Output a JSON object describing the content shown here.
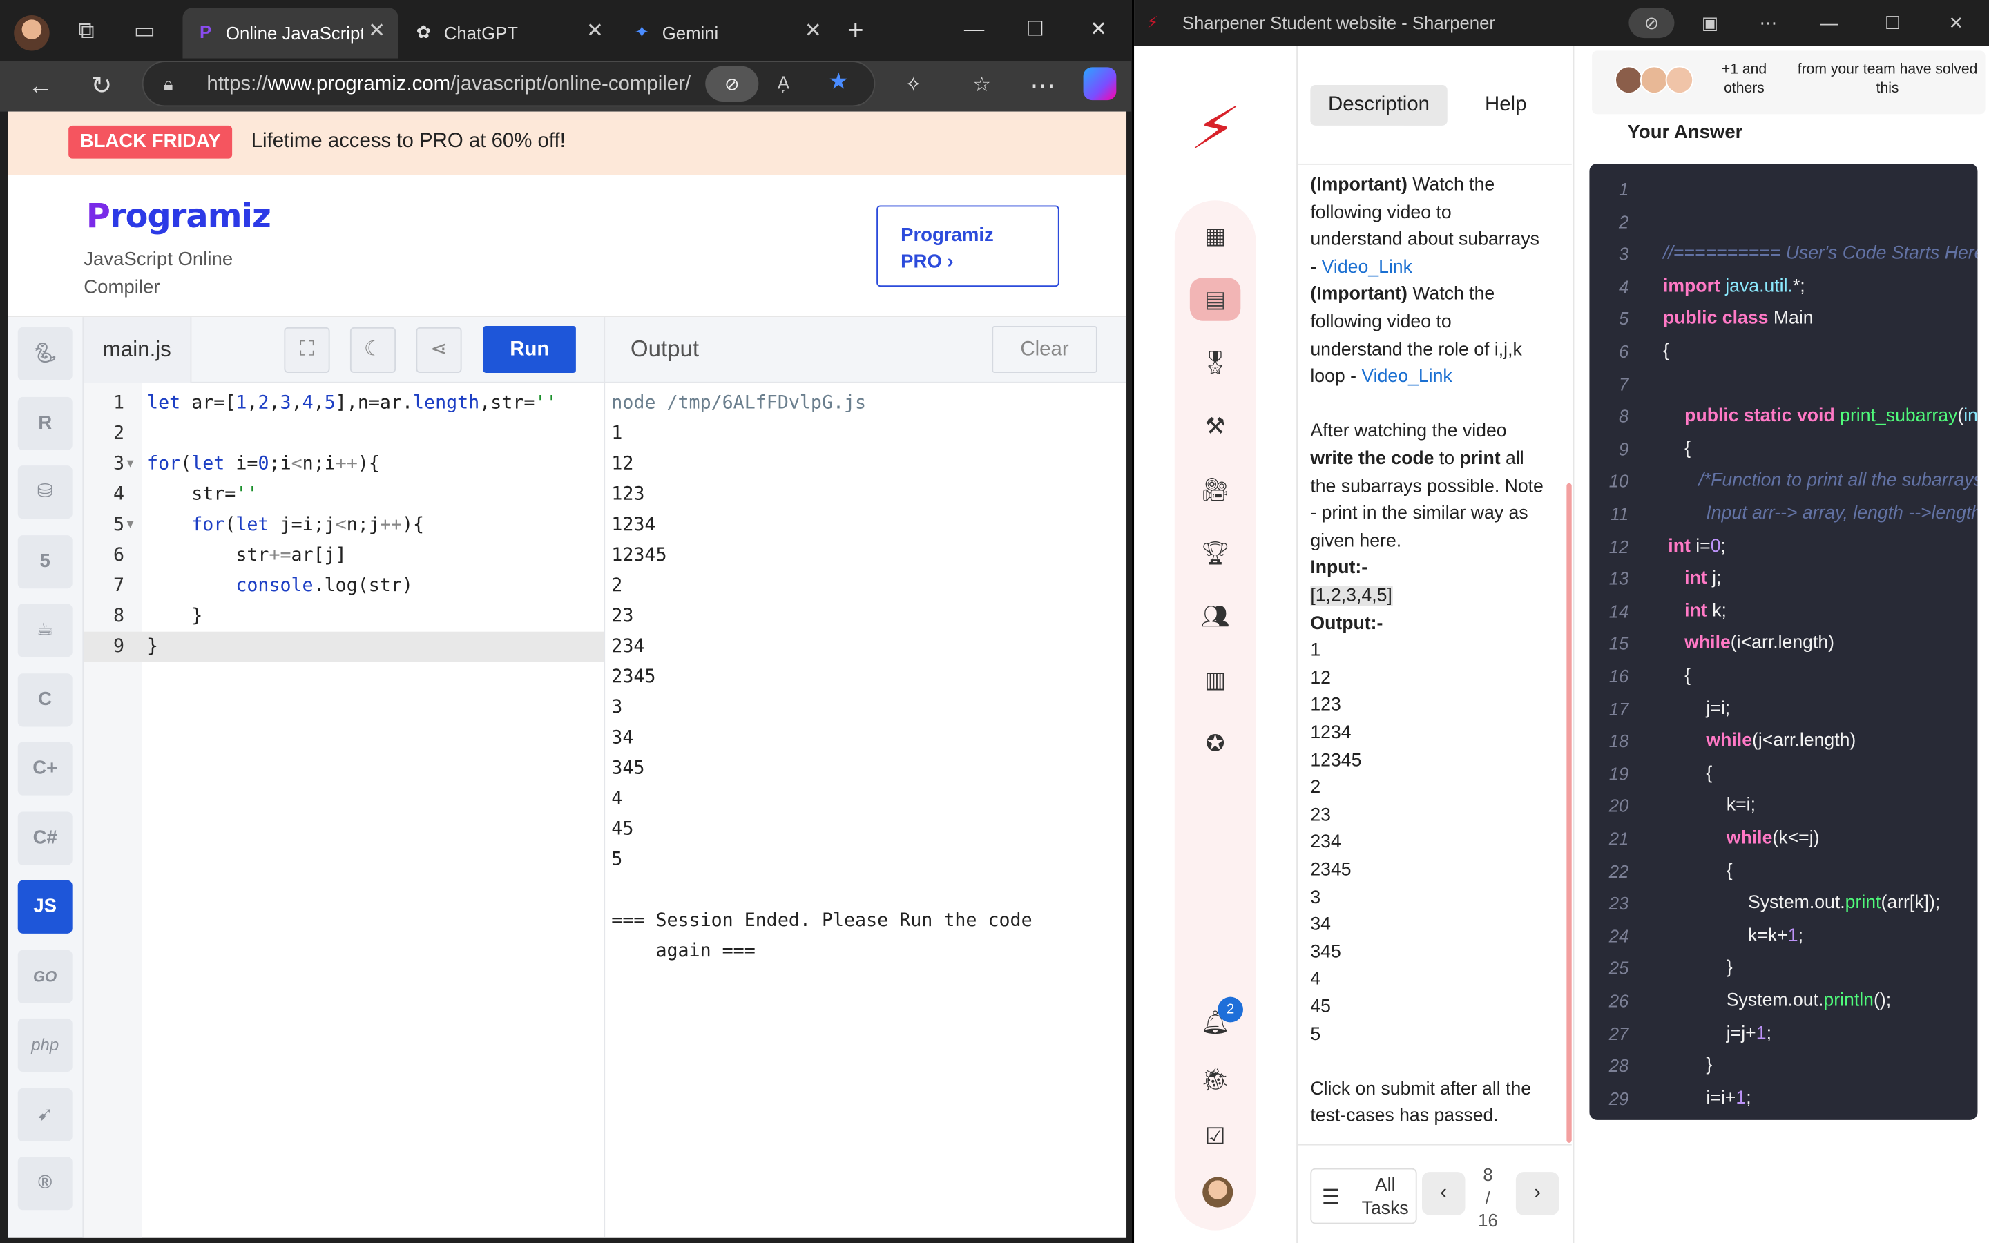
{
  "browser": {
    "tabs": [
      {
        "label": "Online JavaScript C",
        "icon": "programiz-icon"
      },
      {
        "label": "ChatGPT",
        "icon": "chatgpt-icon"
      },
      {
        "label": "Gemini",
        "icon": "gemini-icon"
      }
    ],
    "url_prefix": "https://",
    "url_domain": "www.programiz.com",
    "url_path": "/javascript/online-compiler/"
  },
  "programiz": {
    "promo_badge": "BLACK FRIDAY",
    "promo_text": "Lifetime access to PRO at 60% off!",
    "logo_first": "P",
    "logo_rest": "rogramiz",
    "subtitle": "JavaScript Online Compiler",
    "pro_button": "Programiz PRO ›",
    "languages": [
      "Python",
      "R",
      "SQL",
      "HTML",
      "Java",
      "C",
      "C++",
      "C#",
      "JS",
      "GO",
      "php",
      "Swift",
      "Rust"
    ],
    "active_language": "JS",
    "file_tab": "main.js",
    "run_label": "Run",
    "output_title": "Output",
    "clear_label": "Clear",
    "code_lines": [
      "let ar=[1,2,3,4,5],n=ar.length,str=''",
      "",
      "for(let i=0;i<n;i++){",
      "    str=''",
      "    for(let j=i;j<n;j++){",
      "        str+=ar[j]",
      "        console.log(str)",
      "    }",
      "}"
    ],
    "output_lines": [
      "node /tmp/6ALfFDvlpG.js",
      "1",
      "12",
      "123",
      "1234",
      "12345",
      "2",
      "23",
      "234",
      "2345",
      "3",
      "34",
      "345",
      "4",
      "45",
      "5",
      "",
      "=== Session Ended. Please Run the code",
      "    again ==="
    ]
  },
  "sharpener": {
    "window_title": "Sharpener Student website - Sharpener",
    "tabs": [
      "Description",
      "Help"
    ],
    "active_tab": "Description",
    "notification_count": "2",
    "description_lines": [
      {
        "bold": "(Important)",
        "text": " Watch the"
      },
      {
        "text": "following video to"
      },
      {
        "text": "understand about subarrays"
      },
      {
        "text": "- ",
        "link": "Video_Link"
      },
      {
        "bold": "(Important)",
        "text": " Watch the"
      },
      {
        "text": "following video to"
      },
      {
        "text": "understand the role of i,j,k"
      },
      {
        "text": "loop - ",
        "link": "Video_Link"
      },
      {
        "text": ""
      },
      {
        "text": "After watching the video"
      },
      {
        "rich": "write the code",
        "text": " to ",
        "rich2": "print",
        "text2": " all"
      },
      {
        "text": "the subarrays possible. Note"
      },
      {
        "text": "- print in the similar way as"
      },
      {
        "text": "given here."
      },
      {
        "bold": "Input:-"
      },
      {
        "hl": "[1,2,3,4,5]"
      },
      {
        "bold": "Output:-"
      },
      {
        "text": "1"
      },
      {
        "text": "12"
      },
      {
        "text": "123"
      },
      {
        "text": "1234"
      },
      {
        "text": "12345"
      },
      {
        "text": "2"
      },
      {
        "text": "23"
      },
      {
        "text": "234"
      },
      {
        "text": "2345"
      },
      {
        "text": "3"
      },
      {
        "text": "34"
      },
      {
        "text": "345"
      },
      {
        "text": "4"
      },
      {
        "text": "45"
      },
      {
        "text": "5"
      },
      {
        "text": ""
      },
      {
        "text": "Click on submit after all the"
      },
      {
        "text": "test-cases has passed."
      }
    ],
    "all_tasks": "All Tasks",
    "page_current": "8",
    "page_sep": "/",
    "page_total": "16",
    "solved_count": "+1 and others",
    "solved_msg": "from your team have solved this",
    "your_answer": "Your Answer",
    "answer_line_numbers": [
      "1",
      "2",
      "3",
      "4",
      "5",
      "6",
      "7",
      "8",
      "9",
      "10",
      "11",
      "12",
      "13",
      "14",
      "15",
      "16",
      "17",
      "18",
      "19",
      "20",
      "21",
      "22",
      "23",
      "24",
      "25",
      "26",
      "27",
      "28",
      "29"
    ]
  }
}
